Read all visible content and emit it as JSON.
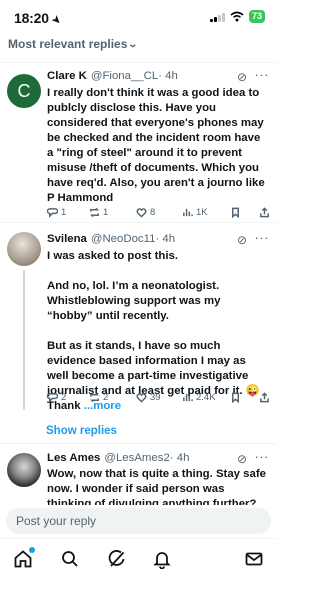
{
  "status_bar": {
    "time": "18:20",
    "battery": "73"
  },
  "sort": {
    "label": "Most relevant replies"
  },
  "replies": [
    {
      "avatar_letter": "C",
      "name": "Clare K",
      "handle": "@Fiona__CL",
      "time": "· 4h",
      "text": "I really don't think it was a good idea to publcly disclose this. Have you considered that everyone's phones may be checked and the incident room have a \"ring of steel\" around it to prevent misuse /theft of documents. Which you have req'd. Also, you aren't a journo like P Hammond",
      "more": "",
      "replies": "1",
      "reposts": "1",
      "likes": "8",
      "views": "1K"
    },
    {
      "avatar_letter": "",
      "name": "Svilena",
      "handle": "@NeoDoc11",
      "time": "· 4h",
      "text": "I was asked to post this.\n\nAnd no, lol. I’m a neonatologist. Whistleblowing support was my “hobby” until recently.\n\nBut as it stands, I have so much evidence based information I may as well become a part-time investigative journalist and at least get paid for it. 😜 Thank",
      "more": "...more",
      "replies": "2",
      "reposts": "2",
      "likes": "39",
      "views": "2.4K"
    },
    {
      "avatar_letter": "",
      "name": "Les Ames",
      "handle": "@LesAmes2",
      "time": "· 4h",
      "text": "Wow, now that is quite a thing. Stay safe now. I wonder if said person was thinking of divulging anything further?",
      "more": "",
      "replies": "",
      "reposts": "",
      "likes": "",
      "views": ""
    }
  ],
  "show_replies": "Show replies",
  "composer": {
    "placeholder": "Post your reply"
  },
  "tabbar": {
    "items": [
      "home-icon",
      "search-icon",
      "grok-icon",
      "notifications-icon",
      "messages-icon"
    ]
  },
  "colors": {
    "accent": "#1d9bf0",
    "text": "#0f1419",
    "muted": "#536471",
    "battery": "#34c759"
  }
}
